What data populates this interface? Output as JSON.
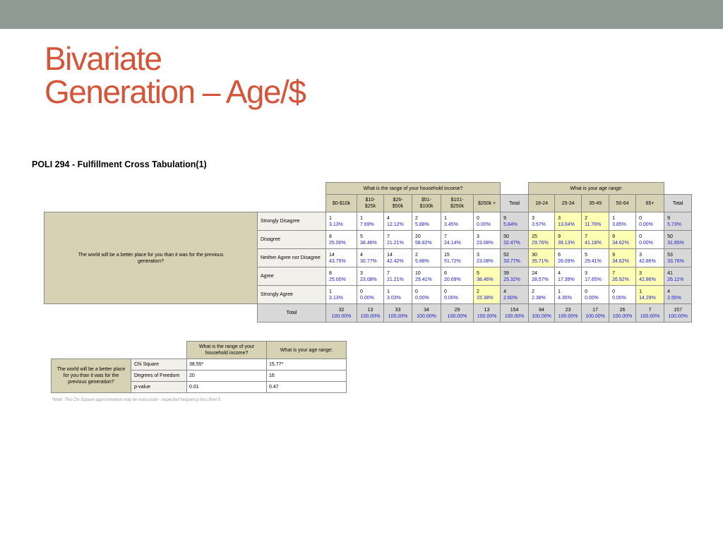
{
  "slide": {
    "title_line1": "Bivariate",
    "title_line2": "Generation – Age/$",
    "table_title": "POLI 294 - Fulfillment Cross Tabulation(1)"
  },
  "crosstab": {
    "income_header": "What is the range of your household income?",
    "age_header": "What is your age range:",
    "income_cols": [
      "$0-$10k",
      "$10-\n$25k",
      "$26-\n$50k",
      "$51-\n$100k",
      "$101-\n$250k",
      "$250k +"
    ],
    "age_cols": [
      "18-24",
      "25-34",
      "35-49",
      "50-64",
      "65+"
    ],
    "total_label": "Total",
    "row_question": "The world will be a better place for you than it was for the previous generation?",
    "rows": [
      {
        "label": "Strongly Disagree",
        "cells": [
          [
            "1",
            "3.13%"
          ],
          [
            "1",
            "7.69%"
          ],
          [
            "4",
            "12.12%"
          ],
          [
            "2",
            "5.88%"
          ],
          [
            "1",
            "3.45%"
          ],
          [
            "0",
            "0.00%"
          ],
          [
            "9",
            "5.84%"
          ],
          [
            "3",
            "3.57%"
          ],
          [
            "3",
            "13.04%"
          ],
          [
            "2",
            "11.76%"
          ],
          [
            "1",
            "3.85%"
          ],
          [
            "0",
            "0.00%"
          ],
          [
            "9",
            "5.73%"
          ]
        ],
        "highlight": [
          false,
          false,
          false,
          false,
          false,
          false,
          false,
          false,
          true,
          true,
          false,
          false,
          false
        ]
      },
      {
        "label": "Disagree",
        "cells": [
          [
            "8",
            "25.00%"
          ],
          [
            "5",
            "38.46%"
          ],
          [
            "7",
            "21.21%"
          ],
          [
            "20",
            "58.82%"
          ],
          [
            "7",
            "24.14%"
          ],
          [
            "3",
            "23.08%"
          ],
          [
            "50",
            "32.47%"
          ],
          [
            "25",
            "29.76%"
          ],
          [
            "9",
            "39.13%"
          ],
          [
            "7",
            "41.18%"
          ],
          [
            "9",
            "34.62%"
          ],
          [
            "0",
            "0.00%"
          ],
          [
            "50",
            "31.85%"
          ]
        ],
        "highlight": [
          false,
          false,
          false,
          false,
          false,
          false,
          false,
          true,
          true,
          true,
          true,
          false,
          false
        ]
      },
      {
        "label": "Neither Agree nor Disagree",
        "cells": [
          [
            "14",
            "43.75%"
          ],
          [
            "4",
            "30.77%"
          ],
          [
            "14",
            "42.42%"
          ],
          [
            "2",
            "5.88%"
          ],
          [
            "15",
            "51.72%"
          ],
          [
            "3",
            "23.08%"
          ],
          [
            "52",
            "33.77%"
          ],
          [
            "30",
            "35.71%"
          ],
          [
            "6",
            "26.09%"
          ],
          [
            "5",
            "29.41%"
          ],
          [
            "9",
            "34.62%"
          ],
          [
            "3",
            "42.86%"
          ],
          [
            "53",
            "33.76%"
          ]
        ],
        "highlight": [
          false,
          false,
          false,
          false,
          false,
          false,
          false,
          true,
          false,
          false,
          true,
          false,
          false
        ]
      },
      {
        "label": "Agree",
        "cells": [
          [
            "8",
            "25.00%"
          ],
          [
            "3",
            "23.08%"
          ],
          [
            "7",
            "21.21%"
          ],
          [
            "10",
            "29.41%"
          ],
          [
            "6",
            "20.69%"
          ],
          [
            "5",
            "38.46%"
          ],
          [
            "39",
            "25.32%"
          ],
          [
            "24",
            "28.57%"
          ],
          [
            "4",
            "17.39%"
          ],
          [
            "3",
            "17.65%"
          ],
          [
            "7",
            "26.92%"
          ],
          [
            "3",
            "42.86%"
          ],
          [
            "41",
            "26.11%"
          ]
        ],
        "highlight": [
          false,
          false,
          false,
          false,
          false,
          true,
          false,
          false,
          false,
          false,
          true,
          true,
          false
        ]
      },
      {
        "label": "Strongly Agree",
        "cells": [
          [
            "1",
            "3.13%"
          ],
          [
            "0",
            "0.00%"
          ],
          [
            "1",
            "3.03%"
          ],
          [
            "0",
            "0.00%"
          ],
          [
            "0",
            "0.00%"
          ],
          [
            "2",
            "15.38%"
          ],
          [
            "4",
            "2.60%"
          ],
          [
            "2",
            "2.38%"
          ],
          [
            "1",
            "4.35%"
          ],
          [
            "0",
            "0.00%"
          ],
          [
            "0",
            "0.00%"
          ],
          [
            "1",
            "14.29%"
          ],
          [
            "4",
            "2.55%"
          ]
        ],
        "highlight": [
          false,
          false,
          false,
          false,
          false,
          true,
          false,
          false,
          false,
          false,
          false,
          true,
          false
        ]
      }
    ],
    "total_row": {
      "label": "Total",
      "cells": [
        [
          "32",
          "100.00%"
        ],
        [
          "13",
          "100.00%"
        ],
        [
          "33",
          "100.00%"
        ],
        [
          "34",
          "100.00%"
        ],
        [
          "29",
          "100.00%"
        ],
        [
          "13",
          "100.00%"
        ],
        [
          "154",
          "100.00%"
        ],
        [
          "84",
          "100.00%"
        ],
        [
          "23",
          "100.00%"
        ],
        [
          "17",
          "100.00%"
        ],
        [
          "26",
          "100.00%"
        ],
        [
          "7",
          "100.00%"
        ],
        [
          "157",
          "100.00%"
        ]
      ]
    }
  },
  "chisq": {
    "col1": "What is the range of your household income?",
    "col2": "What is your age range:",
    "row_question": "The world will be a better place for you than it was for the previous generation?",
    "rows": [
      {
        "label": "Chi Square",
        "v1": "38.55*",
        "v2": "15.77*"
      },
      {
        "label": "Degrees of Freedom",
        "v1": "20",
        "v2": "16"
      },
      {
        "label": "p-value",
        "v1": "0.01",
        "v2": "0.47"
      }
    ],
    "note": "*Note: The Chi-Square approximation may be inaccurate - expected frequency less than 5."
  },
  "colors": {
    "title": "#d4553a",
    "topbar": "#8f9c96",
    "header_tan": "#d8d2b4",
    "total_gray": "#d8d8d8",
    "highlight_yellow": "#fefeb4",
    "percent_blue": "#1a1acf"
  }
}
